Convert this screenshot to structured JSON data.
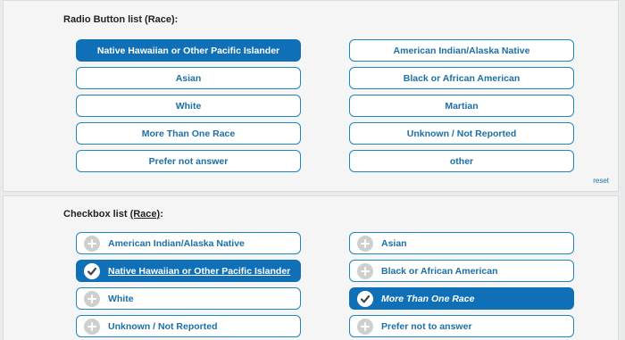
{
  "radio": {
    "title": "Radio Button list (Race):",
    "reset_label": "reset",
    "options": [
      {
        "label": "Native Hawaiian or Other Pacific Islander",
        "selected": true
      },
      {
        "label": "American Indian/Alaska Native",
        "selected": false
      },
      {
        "label": "Asian",
        "selected": false
      },
      {
        "label": "Black or African American",
        "selected": false
      },
      {
        "label": "White",
        "selected": false
      },
      {
        "label": "Martian",
        "selected": false
      },
      {
        "label": "More Than One Race",
        "selected": false
      },
      {
        "label": "Unknown / Not Reported",
        "selected": false
      },
      {
        "label": "Prefer not answer",
        "selected": false
      },
      {
        "label": "other",
        "selected": false
      }
    ]
  },
  "checkbox": {
    "title_prefix": "Checkbox list ",
    "title_link": "(Race)",
    "title_suffix": ":",
    "options": [
      {
        "label": "American Indian/Alaska Native",
        "checked": false
      },
      {
        "label": "Asian",
        "checked": false
      },
      {
        "label": "Native Hawaiian or Other Pacific Islander",
        "checked": true
      },
      {
        "label": "Black or African American",
        "checked": false
      },
      {
        "label": "White",
        "checked": false
      },
      {
        "label": "More Than One Race",
        "checked": true
      },
      {
        "label": "Unknown / Not Reported",
        "checked": false
      },
      {
        "label": "Prefer not to answer",
        "checked": false
      }
    ]
  },
  "colors": {
    "accent": "#0f70b7",
    "border": "#1d86c0",
    "text": "#1d6fa5",
    "icon_inactive": "#cfcfcf"
  }
}
